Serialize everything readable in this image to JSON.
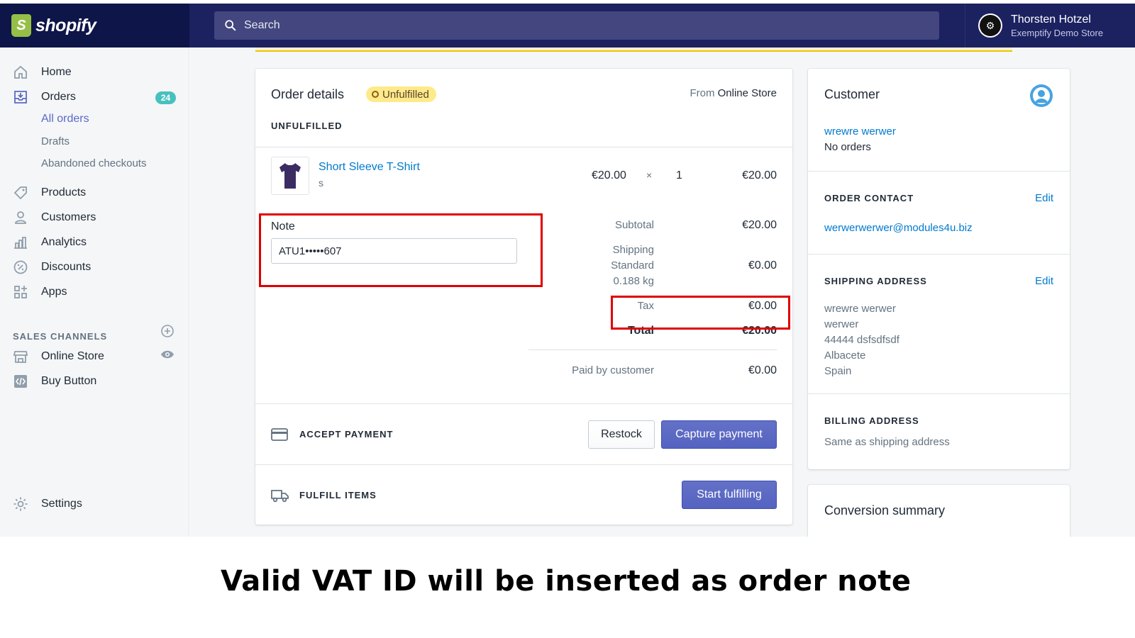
{
  "app": {
    "brand": "shopify"
  },
  "search": {
    "placeholder": "Search"
  },
  "user": {
    "name": "Thorsten Hotzel",
    "store": "Exemptify Demo Store"
  },
  "sidebar": {
    "home": "Home",
    "orders": "Orders",
    "orders_badge": "24",
    "orders_sub": [
      "All orders",
      "Drafts",
      "Abandoned checkouts"
    ],
    "products": "Products",
    "customers": "Customers",
    "analytics": "Analytics",
    "discounts": "Discounts",
    "apps": "Apps",
    "sales_channels_title": "SALES CHANNELS",
    "online_store": "Online Store",
    "buy_button": "Buy Button",
    "settings": "Settings"
  },
  "order": {
    "title": "Order details",
    "status": "Unfulfilled",
    "from_prefix": "From",
    "from_source": "Online Store",
    "section_label": "UNFULFILLED",
    "item": {
      "name": "Short Sleeve T-Shirt",
      "variant": "s",
      "price": "€20.00",
      "times": "×",
      "qty": "1",
      "total": "€20.00"
    },
    "note_label": "Note",
    "note_value": "ATU1•••••607",
    "summary": {
      "subtotal_label": "Subtotal",
      "subtotal_value": "€20.00",
      "shipping_label": "Shipping",
      "shipping_method": "Standard",
      "shipping_weight": "0.188 kg",
      "shipping_value": "€0.00",
      "tax_label": "Tax",
      "tax_value": "€0.00",
      "total_label": "Total",
      "total_value": "€20.00",
      "paid_label": "Paid by customer",
      "paid_value": "€0.00"
    },
    "accept_payment_label": "ACCEPT PAYMENT",
    "restock_label": "Restock",
    "capture_label": "Capture payment",
    "fulfill_label": "FULFILL ITEMS",
    "start_fulfilling_label": "Start fulfilling"
  },
  "customer": {
    "title": "Customer",
    "name": "wrewre werwer",
    "orders": "No orders",
    "contact_title": "ORDER CONTACT",
    "contact_edit": "Edit",
    "email": "werwerwerwer@modules4u.biz",
    "shipping_title": "SHIPPING ADDRESS",
    "shipping_edit": "Edit",
    "address": [
      "wrewre werwer",
      "werwer",
      "44444 dsfsdfsdf",
      "Albacete",
      "Spain"
    ],
    "billing_title": "BILLING ADDRESS",
    "billing_text": "Same as shipping address"
  },
  "conversion": {
    "title": "Conversion summary"
  },
  "caption": "Valid VAT ID will be inserted as order note",
  "colors": {
    "accent": "#5c6ac4",
    "topbar": "#1c2260",
    "highlight": "#e00000",
    "badge": "#47c1bf"
  }
}
